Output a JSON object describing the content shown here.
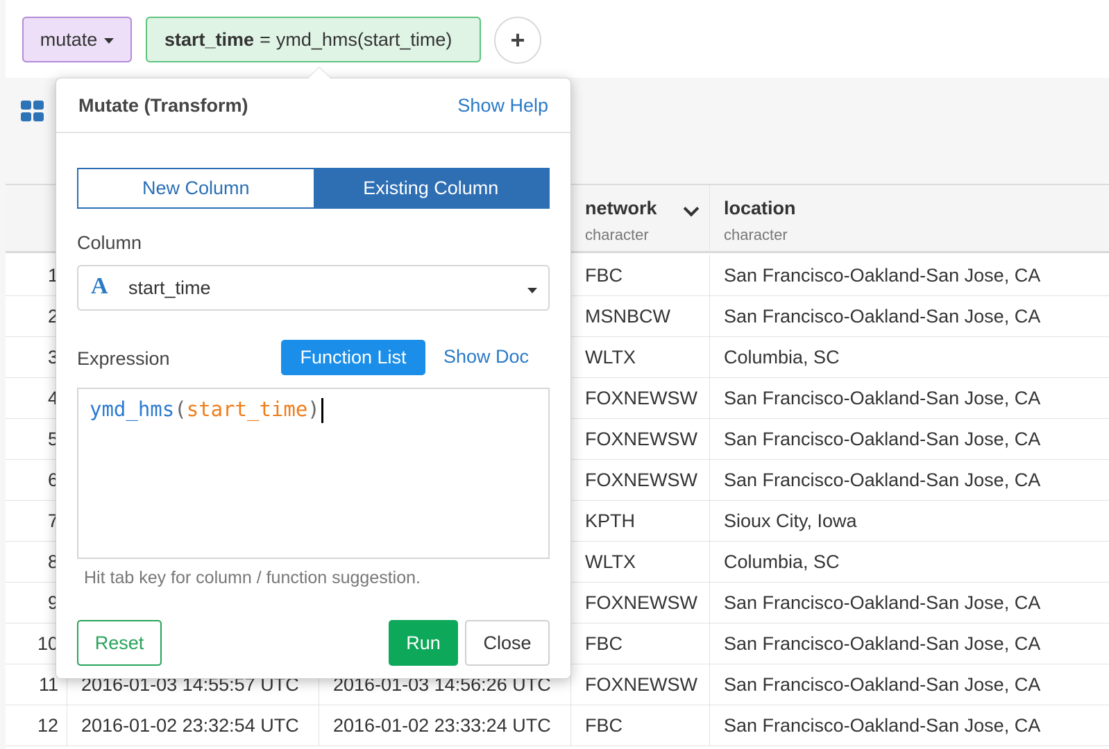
{
  "command_bar": {
    "verb_label": "mutate",
    "expression": {
      "column": "start_time",
      "operator": "=",
      "value": "ymd_hms(start_time)"
    },
    "add_label": "+"
  },
  "popover": {
    "title": "Mutate (Transform)",
    "show_help": "Show Help",
    "tabs": {
      "new_column": "New Column",
      "existing_column": "Existing Column",
      "selected": "existing_column"
    },
    "column_label": "Column",
    "column_type_icon": "A",
    "column_value": "start_time",
    "expression_label": "Expression",
    "function_list": "Function List",
    "show_doc": "Show Doc",
    "editor": {
      "fn": "ymd_hms",
      "open": "(",
      "arg": "start_time",
      "close": ")"
    },
    "hint": "Hit tab key for column / function suggestion.",
    "reset": "Reset",
    "run": "Run",
    "close": "Close"
  },
  "table": {
    "columns": [
      {
        "name": "network",
        "type": "character"
      },
      {
        "name": "location",
        "type": "character"
      }
    ],
    "rows": [
      {
        "idx": "1",
        "c1": "",
        "c2": "",
        "network": "FBC",
        "location": "San Francisco-Oakland-San Jose, CA"
      },
      {
        "idx": "2",
        "c1": "",
        "c2": "",
        "network": "MSNBCW",
        "location": "San Francisco-Oakland-San Jose, CA"
      },
      {
        "idx": "3",
        "c1": "",
        "c2": "",
        "network": "WLTX",
        "location": "Columbia, SC"
      },
      {
        "idx": "4",
        "c1": "",
        "c2": "",
        "network": "FOXNEWSW",
        "location": "San Francisco-Oakland-San Jose, CA"
      },
      {
        "idx": "5",
        "c1": "",
        "c2": "",
        "network": "FOXNEWSW",
        "location": "San Francisco-Oakland-San Jose, CA"
      },
      {
        "idx": "6",
        "c1": "",
        "c2": "",
        "network": "FOXNEWSW",
        "location": "San Francisco-Oakland-San Jose, CA"
      },
      {
        "idx": "7",
        "c1": "",
        "c2": "",
        "network": "KPTH",
        "location": "Sioux City, Iowa"
      },
      {
        "idx": "8",
        "c1": "",
        "c2": "",
        "network": "WLTX",
        "location": "Columbia, SC"
      },
      {
        "idx": "9",
        "c1": "",
        "c2": "",
        "network": "FOXNEWSW",
        "location": "San Francisco-Oakland-San Jose, CA"
      },
      {
        "idx": "10",
        "c1": "",
        "c2": "",
        "network": "FBC",
        "location": "San Francisco-Oakland-San Jose, CA"
      },
      {
        "idx": "11",
        "c1": "2016-01-03 14:55:57 UTC",
        "c2": "2016-01-03 14:56:26 UTC",
        "network": "FOXNEWSW",
        "location": "San Francisco-Oakland-San Jose, CA"
      },
      {
        "idx": "12",
        "c1": "2016-01-02 23:32:54 UTC",
        "c2": "2016-01-02 23:33:24 UTC",
        "network": "FBC",
        "location": "San Francisco-Oakland-San Jose, CA"
      }
    ]
  },
  "colors": {
    "accent": "#2e6fb4",
    "run": "#0ea85a",
    "verb_bg": "#ecdff7",
    "expr_bg": "#e0f4e6"
  }
}
